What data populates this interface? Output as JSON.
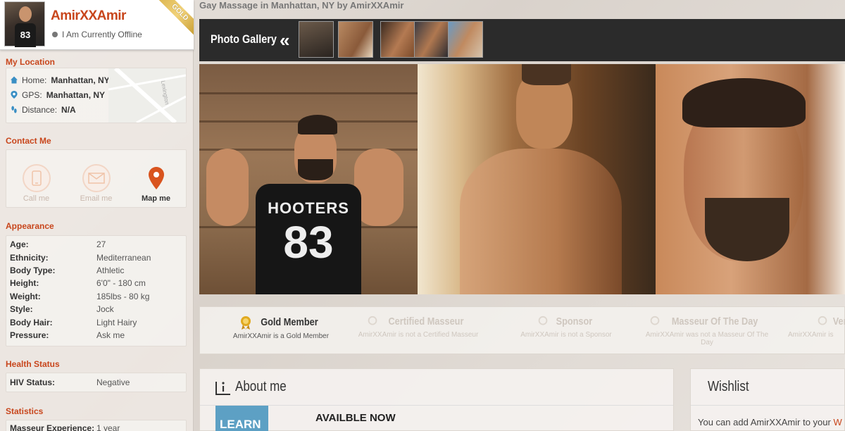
{
  "profile": {
    "name": "AmirXXAmir",
    "status": "I Am Currently Offline",
    "ribbon": "GOLD",
    "avatar_jersey": "83"
  },
  "sidebar": {
    "location": {
      "title": "My Location",
      "home_label": "Home:",
      "home_value": "Manhattan, NY",
      "gps_label": "GPS:",
      "gps_value": "Manhattan, NY",
      "distance_label": "Distance:",
      "distance_value": "N/A",
      "map_street": "Lexington"
    },
    "contact": {
      "title": "Contact Me",
      "call": "Call me",
      "email": "Email me",
      "map": "Map me"
    },
    "appearance": {
      "title": "Appearance",
      "rows": [
        {
          "k": "Age:",
          "v": "27"
        },
        {
          "k": "Ethnicity:",
          "v": "Mediterranean"
        },
        {
          "k": "Body Type:",
          "v": "Athletic"
        },
        {
          "k": "Height:",
          "v": "6'0\" - 180 cm"
        },
        {
          "k": "Weight:",
          "v": "185lbs - 80 kg"
        },
        {
          "k": "Style:",
          "v": "Jock"
        },
        {
          "k": "Body Hair:",
          "v": "Light Hairy"
        },
        {
          "k": "Pressure:",
          "v": "Ask me"
        }
      ]
    },
    "health": {
      "title": "Health Status",
      "hiv_label": "HIV Status:",
      "hiv_value": "Negative"
    },
    "statistics": {
      "title": "Statistics",
      "exp_label": "Masseur Experience:",
      "exp_value": "1 year"
    }
  },
  "main": {
    "heading": "Gay Massage in Manhattan, NY by AmirXXAmir",
    "gallery": {
      "title": "Photo Gallery",
      "prev": "«"
    },
    "hero_shirt": {
      "line1": "HOOTERS",
      "line2": "83"
    },
    "badges": [
      {
        "name": "Gold Member",
        "desc": "AmirXXAmir is a Gold Member"
      },
      {
        "name": "Certified Masseur",
        "desc": "AmirXXAmir is not a Certified Masseur"
      },
      {
        "name": "Sponsor",
        "desc": "AmirXXAmir is not a Sponsor"
      },
      {
        "name": "Masseur Of The Day",
        "desc": "AmirXXAmir was not a Masseur Of The Day"
      },
      {
        "name": "Ver",
        "desc": "AmirXXAmir is"
      }
    ],
    "about": {
      "title": "About me",
      "learn_more": "LEARN MORE",
      "text": "AVAILBLE NOW"
    },
    "wishlist": {
      "title": "Wishlist",
      "text": "You can add AmirXXAmir to your",
      "link_fragment": "W"
    }
  },
  "colors": {
    "accent": "#c8461c",
    "gallery_bar": "#2b2b2b",
    "gold": "#d9b24a",
    "learn_more_bg": "#5da0c4"
  }
}
